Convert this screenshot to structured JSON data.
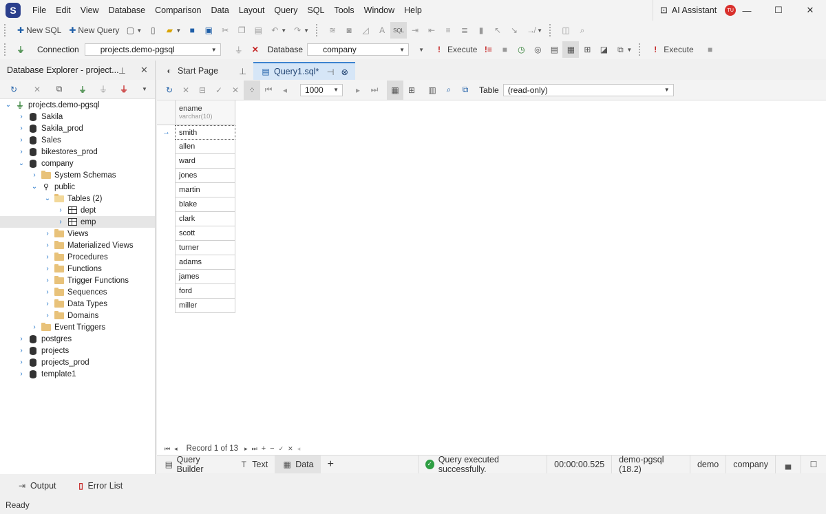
{
  "menu": [
    "File",
    "Edit",
    "View",
    "Database",
    "Comparison",
    "Data",
    "Layout",
    "Query",
    "SQL",
    "Tools",
    "Window",
    "Help"
  ],
  "ai_assistant": {
    "label": "AI Assistant",
    "avatar": "TU"
  },
  "toolbar1": {
    "new_sql": "New SQL",
    "new_query": "New Query"
  },
  "toolbar2": {
    "connection_label": "Connection",
    "connection_value": "projects.demo-pgsql",
    "database_label": "Database",
    "database_value": "company",
    "execute_label": "Execute",
    "execute2_label": "Execute"
  },
  "explorer": {
    "title": "Database Explorer - project...",
    "tree": [
      {
        "label": "projects.demo-pgsql",
        "level": 0,
        "icon": "plug",
        "exp": "open"
      },
      {
        "label": "Sakila",
        "level": 1,
        "icon": "db",
        "exp": "closed"
      },
      {
        "label": "Sakila_prod",
        "level": 1,
        "icon": "db",
        "exp": "closed"
      },
      {
        "label": "Sales",
        "level": 1,
        "icon": "db",
        "exp": "closed"
      },
      {
        "label": "bikestores_prod",
        "level": 1,
        "icon": "db",
        "exp": "closed"
      },
      {
        "label": "company",
        "level": 1,
        "icon": "db",
        "exp": "open"
      },
      {
        "label": "System Schemas",
        "level": 2,
        "icon": "folder",
        "exp": "closed"
      },
      {
        "label": "public",
        "level": 2,
        "icon": "schema",
        "exp": "open"
      },
      {
        "label": "Tables (2)",
        "level": 3,
        "icon": "folder-open",
        "exp": "open"
      },
      {
        "label": "dept",
        "level": 4,
        "icon": "table",
        "exp": "closed"
      },
      {
        "label": "emp",
        "level": 4,
        "icon": "table",
        "exp": "closed",
        "selected": true
      },
      {
        "label": "Views",
        "level": 3,
        "icon": "folder",
        "exp": "closed"
      },
      {
        "label": "Materialized Views",
        "level": 3,
        "icon": "folder",
        "exp": "closed"
      },
      {
        "label": "Procedures",
        "level": 3,
        "icon": "folder",
        "exp": "closed"
      },
      {
        "label": "Functions",
        "level": 3,
        "icon": "folder",
        "exp": "closed"
      },
      {
        "label": "Trigger Functions",
        "level": 3,
        "icon": "folder",
        "exp": "closed"
      },
      {
        "label": "Sequences",
        "level": 3,
        "icon": "folder",
        "exp": "closed"
      },
      {
        "label": "Data Types",
        "level": 3,
        "icon": "folder",
        "exp": "closed"
      },
      {
        "label": "Domains",
        "level": 3,
        "icon": "folder",
        "exp": "closed"
      },
      {
        "label": "Event Triggers",
        "level": 2,
        "icon": "folder",
        "exp": "closed"
      },
      {
        "label": "postgres",
        "level": 1,
        "icon": "db",
        "exp": "closed"
      },
      {
        "label": "projects",
        "level": 1,
        "icon": "db",
        "exp": "closed"
      },
      {
        "label": "projects_prod",
        "level": 1,
        "icon": "db",
        "exp": "closed"
      },
      {
        "label": "template1",
        "level": 1,
        "icon": "db",
        "exp": "closed"
      }
    ]
  },
  "tabs": [
    {
      "label": "Start Page"
    },
    {
      "label": "Query1.sql*"
    }
  ],
  "grid_tools": {
    "limit": "1000",
    "table_label": "Table",
    "table_value": "(read-only)"
  },
  "grid": {
    "column": {
      "name": "ename",
      "type": "varchar(10)"
    },
    "rows": [
      "smith",
      "allen",
      "ward",
      "jones",
      "martin",
      "blake",
      "clark",
      "scott",
      "turner",
      "adams",
      "james",
      "ford",
      "miller"
    ]
  },
  "nav": {
    "record": "Record 1 of 13"
  },
  "bottom_tabs": [
    "Query Builder",
    "Text",
    "Data"
  ],
  "status": {
    "message": "Query executed successfully.",
    "time": "00:00:00.525",
    "connection": "demo-pgsql (18.2)",
    "user": "demo",
    "database": "company"
  },
  "output_tabs": [
    "Output",
    "Error List"
  ],
  "statusbar": {
    "text": "Ready"
  }
}
